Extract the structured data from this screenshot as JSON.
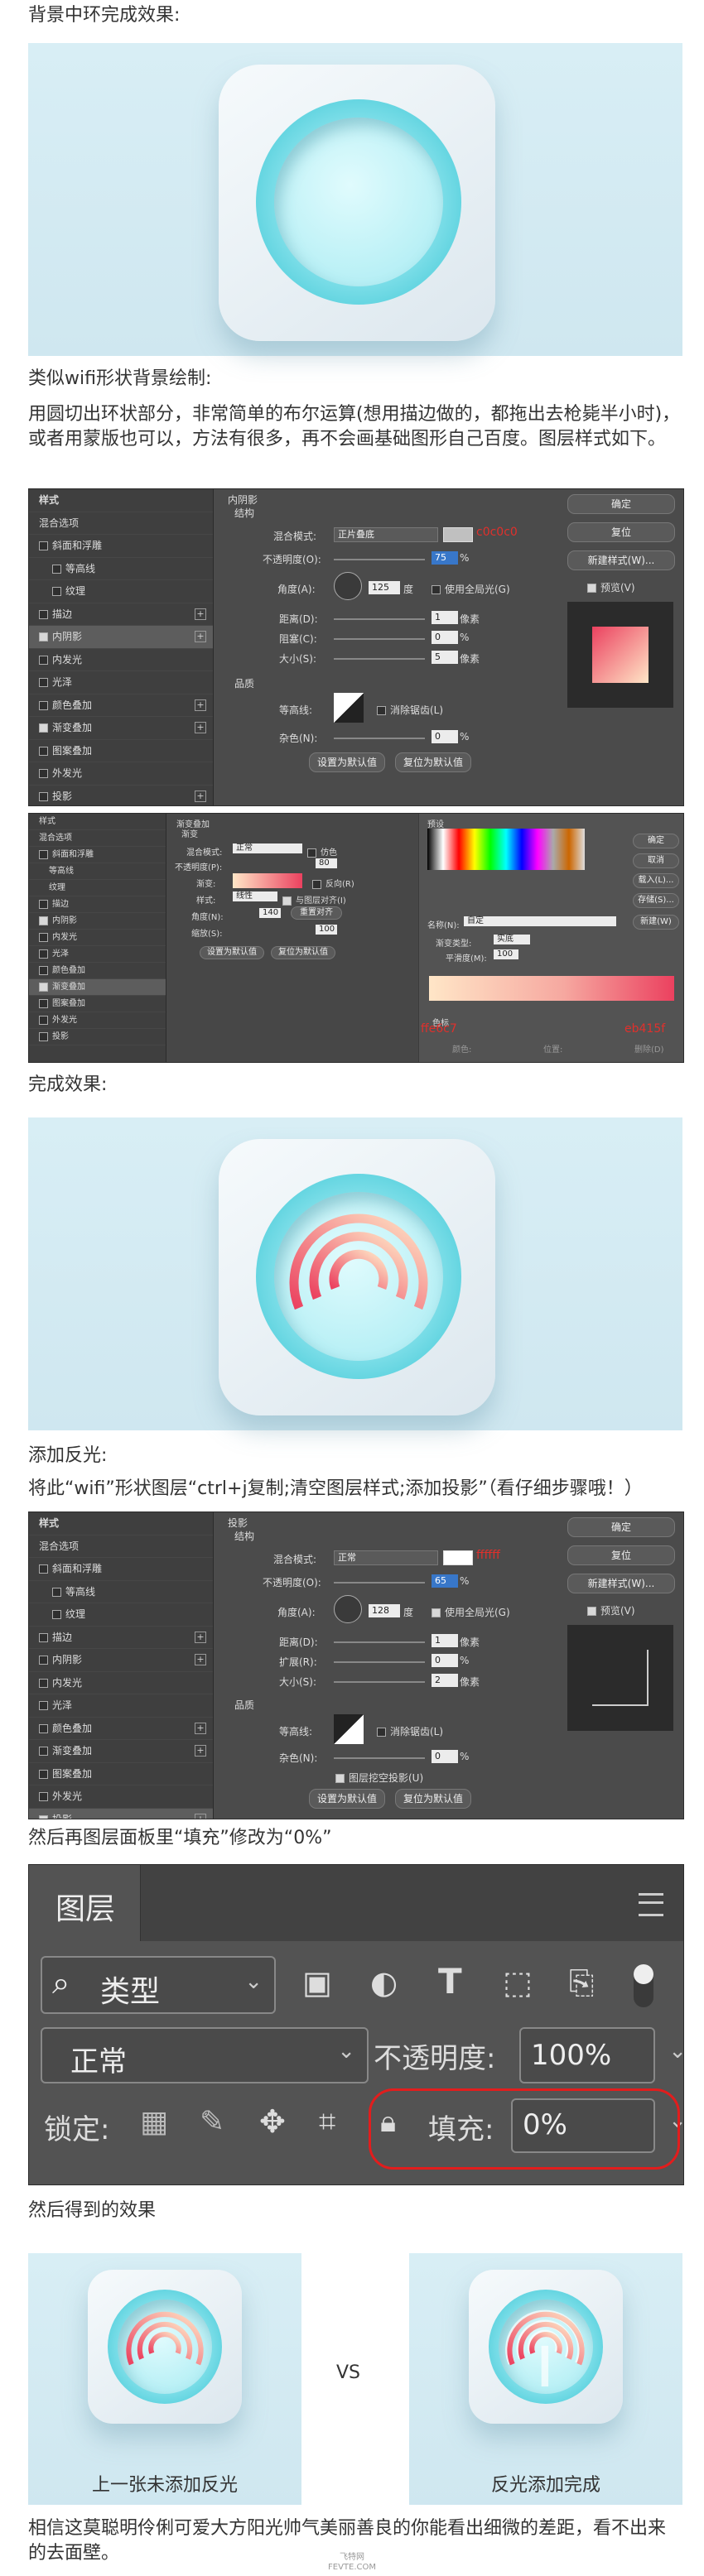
{
  "sections": {
    "t1": "背景中环完成效果:",
    "t2": "类似wifi形状背景绘制:",
    "t3": "用圆切出环状部分，非常简单的布尔运算(想用描边做的，都拖出去枪毙半小时)，或者用蒙版也可以，方法有很多，再不会画基础图形自己百度。图层样式如下。",
    "t4": "完成效果:",
    "t5": "添加反光:",
    "t6": "将此“wifi”形状图层“ctrl+j复制;清空图层样式;添加投影”（看仔细步骤哦！）",
    "t7": "然后再图层面板里“填充”修改为“0%”",
    "t8": "然后得到的效果",
    "t9": "相信这莫聪明伶俐可爱大方阳光帅气美丽善良的你能看出细微的差距，看不出来的去面壁。"
  },
  "ps_common": {
    "style_list": [
      "样式",
      "混合选项",
      "斜面和浮雕",
      "等高线",
      "纹理",
      "描边",
      "内阴影",
      "内发光",
      "光泽",
      "颜色叠加",
      "渐变叠加",
      "图案叠加",
      "外发光",
      "投影"
    ],
    "buttons": {
      "ok": "确定",
      "reset": "复位",
      "new_style": "新建样式(W)...",
      "preview": "预览(V)"
    },
    "set_default": "设置为默认值",
    "reset_default": "复位为默认值"
  },
  "panel1": {
    "title": "内阴影",
    "struct": "结构",
    "blend_label": "混合模式:",
    "blend": "正片叠底",
    "opacity_label": "不透明度(O):",
    "opacity": "75",
    "angle_label": "角度(A):",
    "angle": "125",
    "deg": "度",
    "global": "使用全局光(G)",
    "dist_label": "距离(D):",
    "dist": "1",
    "choke_label": "阻塞(C):",
    "choke": "0",
    "size_label": "大小(S):",
    "size": "5",
    "px": "像素",
    "pct": "%",
    "quality": "品质",
    "contour_label": "等高线:",
    "antialias": "消除锯齿(L)",
    "noise_label": "杂色(N):",
    "noise": "0",
    "color_note": "c0c0c0"
  },
  "panel2": {
    "title": "渐变叠加",
    "grad": "渐变",
    "blend_label": "混合模式:",
    "blend": "正常",
    "dither": "仿色",
    "opacity_label": "不透明度(P):",
    "opacity": "80",
    "grad_label": "渐变:",
    "reverse": "反向(R)",
    "style_label": "样式:",
    "style": "线性",
    "align": "与图层对齐(I)",
    "angle_label": "角度(N):",
    "angle": "140",
    "reset_align": "重置对齐",
    "scale_label": "缩放(S):",
    "scale": "100",
    "presets": "预设",
    "name_label": "名称(N):",
    "name": "自定",
    "new_btn": "新建(W)",
    "type_label": "渐变类型:",
    "type": "实底",
    "smooth_label": "平滑度(M):",
    "smooth": "100",
    "ok": "确定",
    "cancel": "取消",
    "load": "载入(L)...",
    "save": "存储(S)...",
    "stops": "色标",
    "red1": "ffe6c7",
    "red2": "eb415f",
    "opacity2": "不透明度:",
    "location": "位置:",
    "delete": "删除(D)",
    "color": "颜色:"
  },
  "panel3": {
    "title": "投影",
    "struct": "结构",
    "blend_label": "混合模式:",
    "blend": "正常",
    "opacity_label": "不透明度(O):",
    "opacity": "65",
    "angle_label": "角度(A):",
    "angle": "128",
    "deg": "度",
    "global": "使用全局光(G)",
    "dist_label": "距离(D):",
    "dist": "1",
    "spread_label": "扩展(R):",
    "spread": "0",
    "size_label": "大小(S):",
    "size": "2",
    "px": "像素",
    "pct": "%",
    "quality": "品质",
    "contour_label": "等高线:",
    "antialias": "消除锯齿(L)",
    "noise_label": "杂色(N):",
    "noise": "0",
    "knockout": "图层挖空投影(U)",
    "color_note": "ffffff"
  },
  "layers": {
    "title": "图层",
    "filter": "类型",
    "blend": "正常",
    "opacity_label": "不透明度:",
    "opacity": "100%",
    "lock_label": "锁定:",
    "fill_label": "填充:",
    "fill": "0%"
  },
  "compare": {
    "left": "上一张未添加反光",
    "vs": "VS",
    "right": "反光添加完成"
  },
  "watermark": {
    "brand": "飞特网",
    "url": "FEVTE.COM"
  }
}
